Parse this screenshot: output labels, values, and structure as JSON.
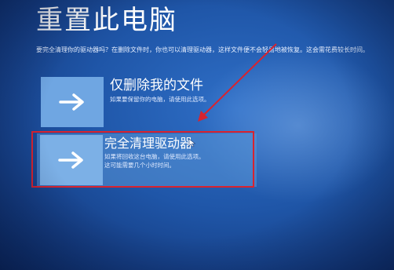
{
  "page": {
    "title": "重置此电脑",
    "description": "要完全清理你的驱动器吗？在删除文件时，你也可以清理驱动器，这样文件便不会轻易地被恢复。这会需花费较长时间。"
  },
  "options": [
    {
      "title": "仅删除我的文件",
      "description": "如果要保留你的电脑，请使用此选项。",
      "icon": "arrow-right-icon"
    },
    {
      "title": "完全清理驱动器",
      "description": "如果将回收这台电脑，请使用此选项。这可能需要几个小时时间。",
      "icon": "arrow-right-icon"
    }
  ],
  "colors": {
    "background": "#1f56a8",
    "tile": "#6fa6e2",
    "highlight_box": "#d8232f",
    "text": "#ffffff"
  }
}
